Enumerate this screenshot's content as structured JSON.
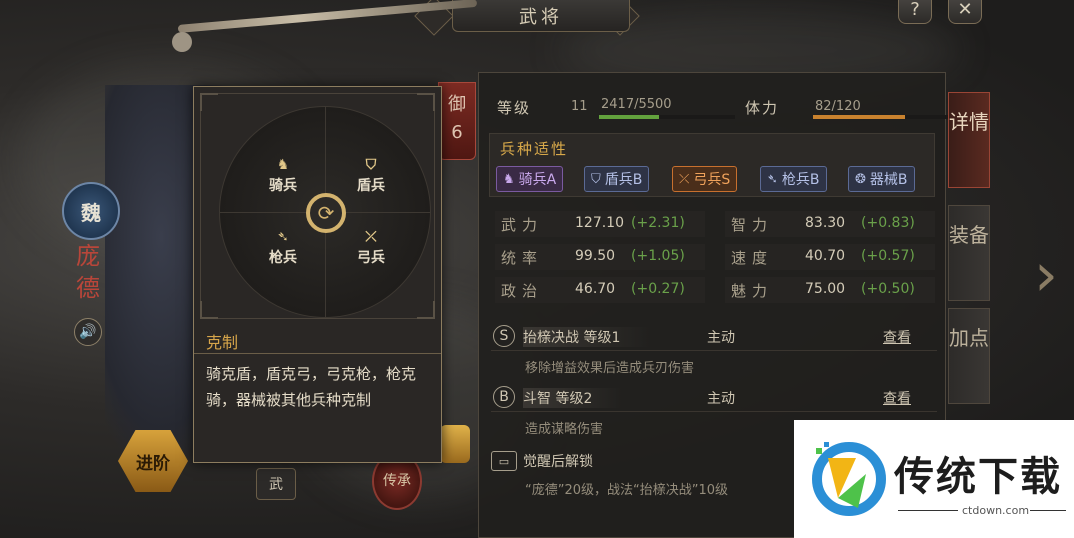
{
  "window": {
    "title": "武将",
    "help_label": "?",
    "close_label": "✕"
  },
  "hero": {
    "faction": "魏",
    "name": "庞德",
    "sound_icon": "speaker-icon",
    "defense_badge": {
      "label": "御",
      "value": "6"
    }
  },
  "bottom_left": {
    "advance_label": "进阶",
    "wu_tab_label": "武",
    "inherit_label": "传承"
  },
  "level": {
    "label": "等级",
    "value": "11",
    "exp_text": "2417/5500",
    "exp_progress": 0.44,
    "stamina_label": "体力",
    "stamina_text": "82/120",
    "stamina_progress": 0.68
  },
  "affinity": {
    "title": "兵种适性",
    "items": [
      {
        "icon": "cavalry-icon",
        "glyph": "♞",
        "label": "骑兵A",
        "grade": "a"
      },
      {
        "icon": "shield-icon",
        "glyph": "⛉",
        "label": "盾兵B",
        "grade": "b"
      },
      {
        "icon": "bow-icon",
        "glyph": "⤫",
        "label": "弓兵S",
        "grade": "s"
      },
      {
        "icon": "spear-icon",
        "glyph": "➴",
        "label": "枪兵B",
        "grade": "b"
      },
      {
        "icon": "siege-icon",
        "glyph": "❂",
        "label": "器械B",
        "grade": "b"
      }
    ]
  },
  "stats": {
    "left": [
      {
        "name": "武力",
        "value": "127.10",
        "bonus": "(+2.31)"
      },
      {
        "name": "统率",
        "value": "99.50",
        "bonus": "(+1.05)"
      },
      {
        "name": "政治",
        "value": "46.70",
        "bonus": "(+0.27)"
      }
    ],
    "right": [
      {
        "name": "智力",
        "value": "83.30",
        "bonus": "(+0.83)"
      },
      {
        "name": "速度",
        "value": "40.70",
        "bonus": "(+0.57)"
      },
      {
        "name": "魅力",
        "value": "75.00",
        "bonus": "(+0.50)"
      }
    ]
  },
  "skills": [
    {
      "grade": "S",
      "name": "抬榇决战 等级1",
      "type": "主动",
      "view": "查看",
      "desc": "移除增益效果后造成兵刃伤害"
    },
    {
      "grade": "B",
      "name": "斗智 等级2",
      "type": "主动",
      "view": "查看",
      "desc": "造成谋略伤害"
    }
  ],
  "awaken": {
    "title": "觉醒后解锁",
    "desc": "“庞德”20级，战法“抬榇决战”10级"
  },
  "side_tabs": [
    {
      "label": "详情",
      "active": true
    },
    {
      "label": "装备",
      "active": false
    },
    {
      "label": "加点",
      "active": false
    }
  ],
  "tooltip": {
    "units": {
      "cavalry": {
        "icon": "cavalry-icon",
        "glyph": "♞",
        "label": "骑兵"
      },
      "shield": {
        "icon": "shield-icon",
        "glyph": "⛉",
        "label": "盾兵"
      },
      "spear": {
        "icon": "spear-icon",
        "glyph": "➴",
        "label": "枪兵"
      },
      "bow": {
        "icon": "bow-icon",
        "glyph": "⤫",
        "label": "弓兵"
      }
    },
    "cycle_icon": "cycle-icon",
    "title": "克制",
    "body": "骑克盾，盾克弓，弓克枪，枪克骑，器械被其他兵种克制"
  },
  "watermark": {
    "text": "传统下载",
    "url": "ctdown.com"
  },
  "colors": {
    "accent_gold": "#d6a54a",
    "bonus_green": "#6aa14a",
    "exp_green": "#63a23d",
    "stamina_orange": "#c9822e",
    "name_red": "#b9463a"
  }
}
